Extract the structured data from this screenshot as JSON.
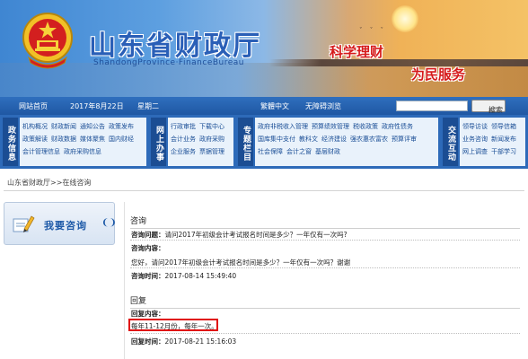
{
  "header": {
    "title": "山东省财政厅",
    "subtitle": "ShandongProvince·FinanceBureau",
    "slogan_1": "科学理财",
    "slogan_2": "为民服务"
  },
  "datebar": {
    "home": "网站首页",
    "date": "2017年8月22日",
    "weekday": "星期二",
    "traditional": "繁體中文",
    "accessible": "无障碍浏览",
    "search_button": "搜索"
  },
  "nav": {
    "block_1": "政务信息",
    "block_2": "网上办事",
    "block_3": "专题栏目",
    "block_4": "交流互动",
    "group_1": [
      "机构概况",
      "财政新闻",
      "通知公告",
      "政策发布",
      "政策解读",
      "财政数据",
      "媒体聚焦",
      "国内财经",
      "会计管理信息",
      "政府采购信息"
    ],
    "group_2": [
      "行政审批",
      "下载中心",
      "会计业务",
      "政府采购",
      "企业服务",
      "票据管理"
    ],
    "group_3": [
      "政府非税收入管理",
      "预算绩效管理",
      "税收政策",
      "政府性债务",
      "国库集中支付",
      "教科文",
      "经济建设",
      "强农惠农富农",
      "预算评审",
      "社会保障",
      "会计之窗",
      "基层财政"
    ],
    "group_4": [
      "领导访谈",
      "领导信箱",
      "业务咨询",
      "新闻发布",
      "网上调查",
      "干部学习"
    ]
  },
  "breadcrumb": "山东省财政厅>>在线咨询",
  "consult_box": {
    "label": "我要咨询"
  },
  "consult": {
    "section_title": "咨询",
    "question_label": "咨询问题：",
    "question": "请问2017年初级会计考试报名时间是多少？一年仅有一次吗?",
    "content_label": "咨询内容：",
    "content": "您好，请问2017年初级会计考试报名时间是多少？一年仅有一次吗？谢谢",
    "time_label": "咨询时间：",
    "time": "2017-08-14 15:49:40"
  },
  "reply": {
    "section_title": "回复",
    "content_label": "回复内容：",
    "content": "每年11-12月份，每年一次。",
    "time_label": "回复时间：",
    "time": "2017-08-21 15:16:03"
  },
  "colors": {
    "nav_bg": "#2d6ab9",
    "nav_block": "#1b4d93",
    "title_blue": "#2a5fb7",
    "slogan_red": "#d61a1a",
    "highlight_red": "#e01010"
  }
}
